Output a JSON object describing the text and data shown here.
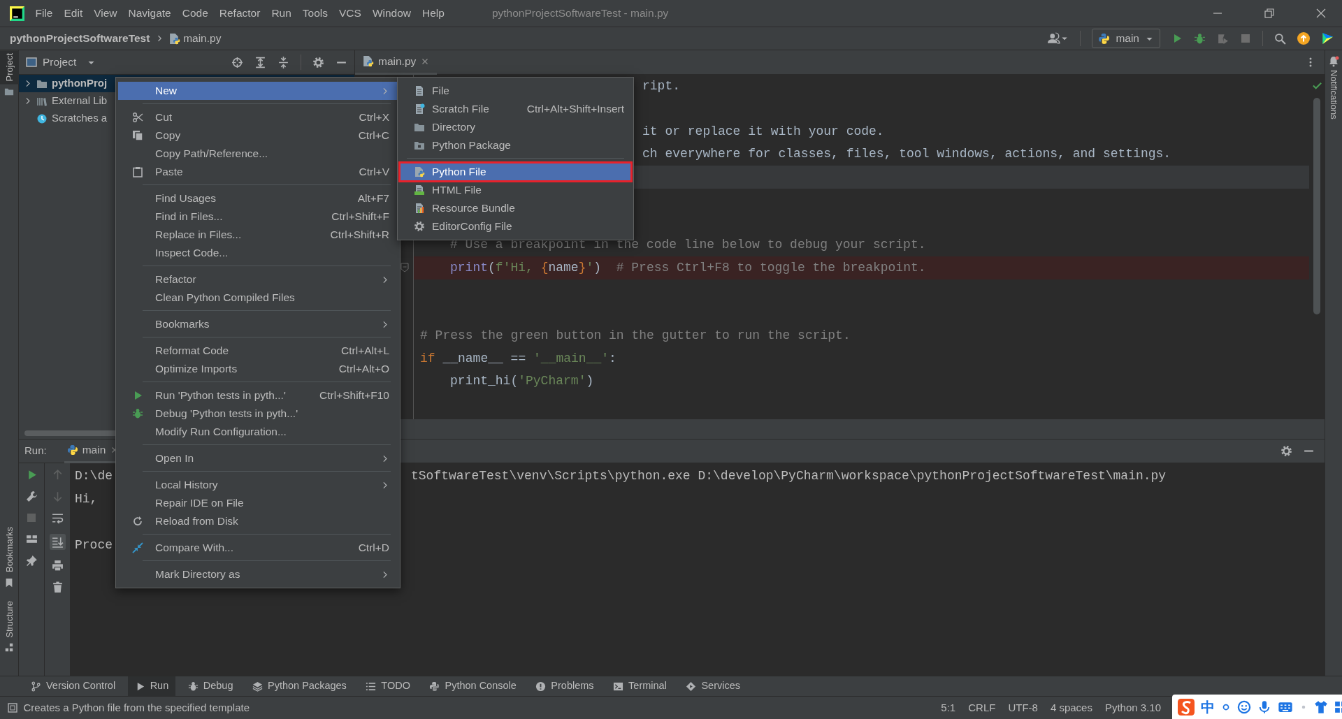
{
  "window": {
    "title": "pythonProjectSoftwareTest - main.py"
  },
  "menu_bar": [
    "File",
    "Edit",
    "View",
    "Navigate",
    "Code",
    "Refactor",
    "Run",
    "Tools",
    "VCS",
    "Window",
    "Help"
  ],
  "nav_bar": {
    "project": "pythonProjectSoftwareTest",
    "file": "main.py",
    "run_config": "main"
  },
  "left_strip": [
    {
      "label": "Project",
      "selected": true
    },
    {
      "label": "Bookmarks",
      "selected": false
    },
    {
      "label": "Structure",
      "selected": false
    }
  ],
  "right_strip": [
    {
      "label": "Notifications"
    }
  ],
  "project_panel": {
    "title": "Project",
    "tree": [
      {
        "kind": "project",
        "label": "pythonProj",
        "selected": true
      },
      {
        "kind": "library",
        "label": "External Lib",
        "selected": false
      },
      {
        "kind": "scratches",
        "label": "Scratches a",
        "selected": false
      }
    ]
  },
  "editor": {
    "tab": "main.py",
    "lines": [
      {
        "kind": "partial",
        "text": "ript.",
        "current": false,
        "breakpoint": false
      },
      {
        "kind": "blank",
        "current": false,
        "breakpoint": false
      },
      {
        "kind": "partial",
        "text": "it or replace it with your code.",
        "current": false,
        "breakpoint": false
      },
      {
        "kind": "partial",
        "text": "ch everywhere for classes, files, tool windows, actions, and settings.",
        "current": false,
        "breakpoint": false
      },
      {
        "kind": "blank",
        "current": true,
        "breakpoint": false
      },
      {
        "kind": "blank",
        "current": false,
        "breakpoint": false
      },
      {
        "kind": "blank",
        "current": false,
        "breakpoint": false
      },
      {
        "kind": "indented",
        "tokens": [
          {
            "kind": "comment",
            "text": "# Use a breakpoint in the code line below to debug your script."
          }
        ],
        "current": false,
        "breakpoint": false,
        "fold_marker": false
      },
      {
        "kind": "indented",
        "tokens": [
          {
            "kind": "builtin",
            "text": "print"
          },
          {
            "kind": "plain",
            "text": "("
          },
          {
            "kind": "string",
            "text": "f'Hi, "
          },
          {
            "kind": "keyword",
            "text": "{"
          },
          {
            "kind": "plain",
            "text": "name"
          },
          {
            "kind": "keyword",
            "text": "}"
          },
          {
            "kind": "string",
            "text": "'"
          },
          {
            "kind": "plain",
            "text": ")  "
          },
          {
            "kind": "comment",
            "text": "# Press Ctrl+F8 to toggle the breakpoint."
          }
        ],
        "current": false,
        "breakpoint": true,
        "fold_marker": true
      },
      {
        "kind": "blank",
        "current": false,
        "breakpoint": false,
        "fold_marker": false
      },
      {
        "kind": "blank",
        "current": false,
        "breakpoint": false,
        "fold_marker": false
      },
      {
        "kind": "code",
        "tokens": [
          {
            "kind": "comment",
            "text": "# Press the green button in the gutter to run the script."
          }
        ],
        "current": false,
        "breakpoint": false,
        "fold_marker": false
      },
      {
        "kind": "code",
        "tokens": [
          {
            "kind": "keyword",
            "text": "if "
          },
          {
            "kind": "plain",
            "text": "__name__ == "
          },
          {
            "kind": "string",
            "text": "'__main__'"
          },
          {
            "kind": "plain",
            "text": ":"
          }
        ],
        "current": false,
        "breakpoint": false,
        "fold_marker": false
      },
      {
        "kind": "indented",
        "tokens": [
          {
            "kind": "plain",
            "text": "print_hi("
          },
          {
            "kind": "string",
            "text": "'PyCharm'"
          },
          {
            "kind": "plain",
            "text": ")"
          }
        ],
        "current": false,
        "breakpoint": false,
        "fold_marker": false
      }
    ]
  },
  "run_panel": {
    "label": "Run:",
    "tab": "main",
    "console": [
      {
        "kind": "text",
        "left": "D:\\de",
        "right": "tSoftwareTest\\venv\\Scripts\\python.exe D:\\develop\\PyCharm\\workspace\\pythonProjectSoftwareTest\\main.py"
      },
      {
        "kind": "text",
        "left": "Hi,"
      },
      {
        "kind": "blank"
      },
      {
        "kind": "text",
        "left": "Proce"
      }
    ]
  },
  "tool_tabs": [
    {
      "label": "Version Control",
      "selected": false
    },
    {
      "label": "Run",
      "selected": true
    },
    {
      "label": "Debug",
      "selected": false
    },
    {
      "label": "Python Packages",
      "selected": false
    },
    {
      "label": "TODO",
      "selected": false
    },
    {
      "label": "Python Console",
      "selected": false
    },
    {
      "label": "Problems",
      "selected": false
    },
    {
      "label": "Terminal",
      "selected": false
    },
    {
      "label": "Services",
      "selected": false
    }
  ],
  "status_bar": {
    "message": "Creates a Python file from the specified template",
    "items": [
      "5:1",
      "CRLF",
      "UTF-8",
      "4 spaces",
      "Python 3.10"
    ]
  },
  "ime_bar": {
    "mode": "中"
  },
  "context_menu": {
    "items": [
      {
        "kind": "item",
        "label": "New",
        "submenu": true,
        "selected": true
      },
      {
        "kind": "separator"
      },
      {
        "kind": "item",
        "label": "Cut",
        "shortcut": "Ctrl+X",
        "submenu": false,
        "selected": false
      },
      {
        "kind": "item",
        "label": "Copy",
        "shortcut": "Ctrl+C",
        "submenu": false,
        "selected": false
      },
      {
        "kind": "item",
        "label": "Copy Path/Reference...",
        "submenu": false,
        "selected": false
      },
      {
        "kind": "item",
        "label": "Paste",
        "shortcut": "Ctrl+V",
        "submenu": false,
        "selected": false
      },
      {
        "kind": "separator"
      },
      {
        "kind": "item",
        "label": "Find Usages",
        "shortcut": "Alt+F7",
        "submenu": false,
        "selected": false
      },
      {
        "kind": "item",
        "label": "Find in Files...",
        "shortcut": "Ctrl+Shift+F",
        "submenu": false,
        "selected": false
      },
      {
        "kind": "item",
        "label": "Replace in Files...",
        "shortcut": "Ctrl+Shift+R",
        "submenu": false,
        "selected": false
      },
      {
        "kind": "item",
        "label": "Inspect Code...",
        "submenu": false,
        "selected": false
      },
      {
        "kind": "separator"
      },
      {
        "kind": "item",
        "label": "Refactor",
        "submenu": true,
        "selected": false
      },
      {
        "kind": "item",
        "label": "Clean Python Compiled Files",
        "submenu": false,
        "selected": false
      },
      {
        "kind": "separator"
      },
      {
        "kind": "item",
        "label": "Bookmarks",
        "submenu": true,
        "selected": false
      },
      {
        "kind": "separator"
      },
      {
        "kind": "item",
        "label": "Reformat Code",
        "shortcut": "Ctrl+Alt+L",
        "submenu": false,
        "selected": false
      },
      {
        "kind": "item",
        "label": "Optimize Imports",
        "shortcut": "Ctrl+Alt+O",
        "submenu": false,
        "selected": false
      },
      {
        "kind": "separator"
      },
      {
        "kind": "item",
        "label": "Run 'Python tests in pyth...'",
        "shortcut": "Ctrl+Shift+F10",
        "submenu": false,
        "selected": false
      },
      {
        "kind": "item",
        "label": "Debug 'Python tests in pyth...'",
        "submenu": false,
        "selected": false
      },
      {
        "kind": "item",
        "label": "Modify Run Configuration...",
        "submenu": false,
        "selected": false
      },
      {
        "kind": "separator"
      },
      {
        "kind": "item",
        "label": "Open In",
        "submenu": true,
        "selected": false
      },
      {
        "kind": "separator"
      },
      {
        "kind": "item",
        "label": "Local History",
        "submenu": true,
        "selected": false
      },
      {
        "kind": "item",
        "label": "Repair IDE on File",
        "submenu": false,
        "selected": false
      },
      {
        "kind": "item",
        "label": "Reload from Disk",
        "submenu": false,
        "selected": false
      },
      {
        "kind": "separator"
      },
      {
        "kind": "item",
        "label": "Compare With...",
        "shortcut": "Ctrl+D",
        "submenu": false,
        "selected": false
      },
      {
        "kind": "separator"
      },
      {
        "kind": "item",
        "label": "Mark Directory as",
        "submenu": true,
        "selected": false
      }
    ]
  },
  "new_submenu": {
    "items": [
      {
        "kind": "item",
        "label": "File",
        "selected": false,
        "outlined": false
      },
      {
        "kind": "item",
        "label": "Scratch File",
        "shortcut": "Ctrl+Alt+Shift+Insert",
        "selected": false,
        "outlined": false
      },
      {
        "kind": "item",
        "label": "Directory",
        "selected": false,
        "outlined": false
      },
      {
        "kind": "item",
        "label": "Python Package",
        "selected": false,
        "outlined": false
      },
      {
        "kind": "separator"
      },
      {
        "kind": "item",
        "label": "Python File",
        "selected": true,
        "outlined": true
      },
      {
        "kind": "item",
        "label": "HTML File",
        "selected": false,
        "outlined": false
      },
      {
        "kind": "item",
        "label": "Resource Bundle",
        "selected": false,
        "outlined": false
      },
      {
        "kind": "item",
        "label": "EditorConfig File",
        "selected": false,
        "outlined": false
      }
    ]
  }
}
